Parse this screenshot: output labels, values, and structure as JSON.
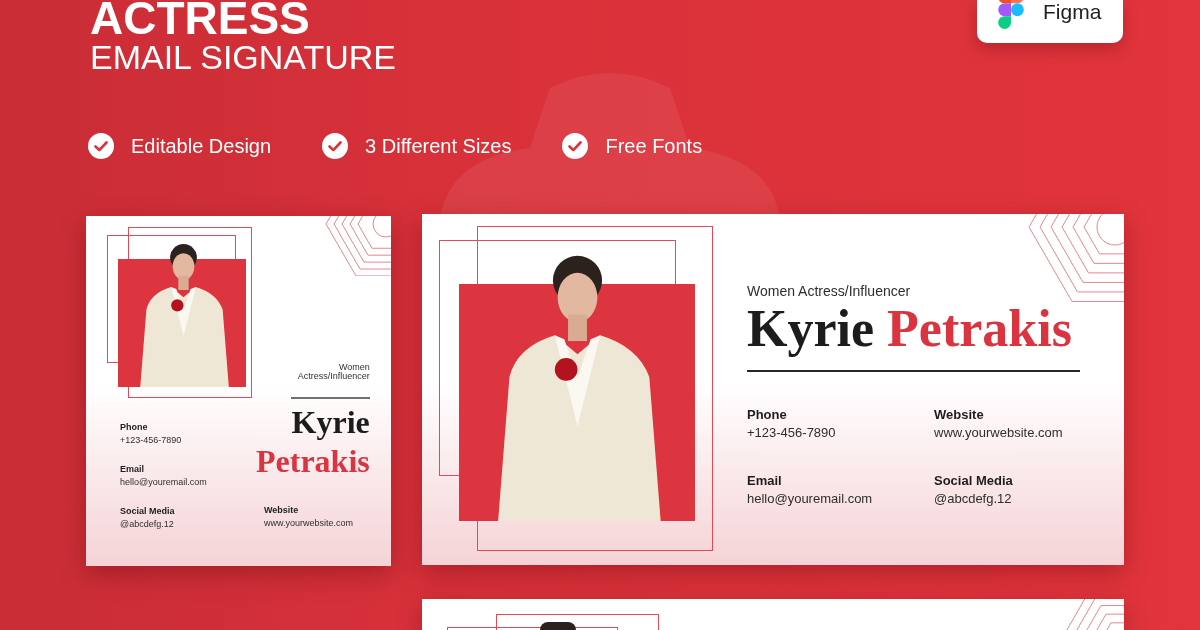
{
  "header": {
    "title_top": "ACTRESS",
    "title": "EMAIL SIGNATURE"
  },
  "badge": {
    "label": "Figma"
  },
  "features": [
    {
      "label": "Editable Design"
    },
    {
      "label": "3 Different Sizes"
    },
    {
      "label": "Free Fonts"
    }
  ],
  "signatures": [
    {
      "kind": "square",
      "role_lines": [
        "Women",
        "Actress/Influencer"
      ],
      "first_name": "Kyrie",
      "last_name": "Petrakis",
      "contacts": [
        {
          "label": "Phone",
          "value": "+123-456-7890"
        },
        {
          "label": "Email",
          "value": "hello@youremail.com"
        },
        {
          "label": "Social Media",
          "value": "@abcdefg.12"
        },
        {
          "label": "Website",
          "value": "www.yourwebsite.com"
        }
      ]
    },
    {
      "kind": "wide",
      "role_lines": [
        "Women Actress/Influencer"
      ],
      "first_name": "Kyrie",
      "last_name": "Petrakis",
      "contacts": [
        {
          "label": "Phone",
          "value": "+123-456-7890"
        },
        {
          "label": "Website",
          "value": "www.yourwebsite.com"
        },
        {
          "label": "Email",
          "value": "hello@youremail.com"
        },
        {
          "label": "Social Media",
          "value": "@abcdefg.12"
        }
      ]
    },
    {
      "kind": "partial"
    }
  ]
}
